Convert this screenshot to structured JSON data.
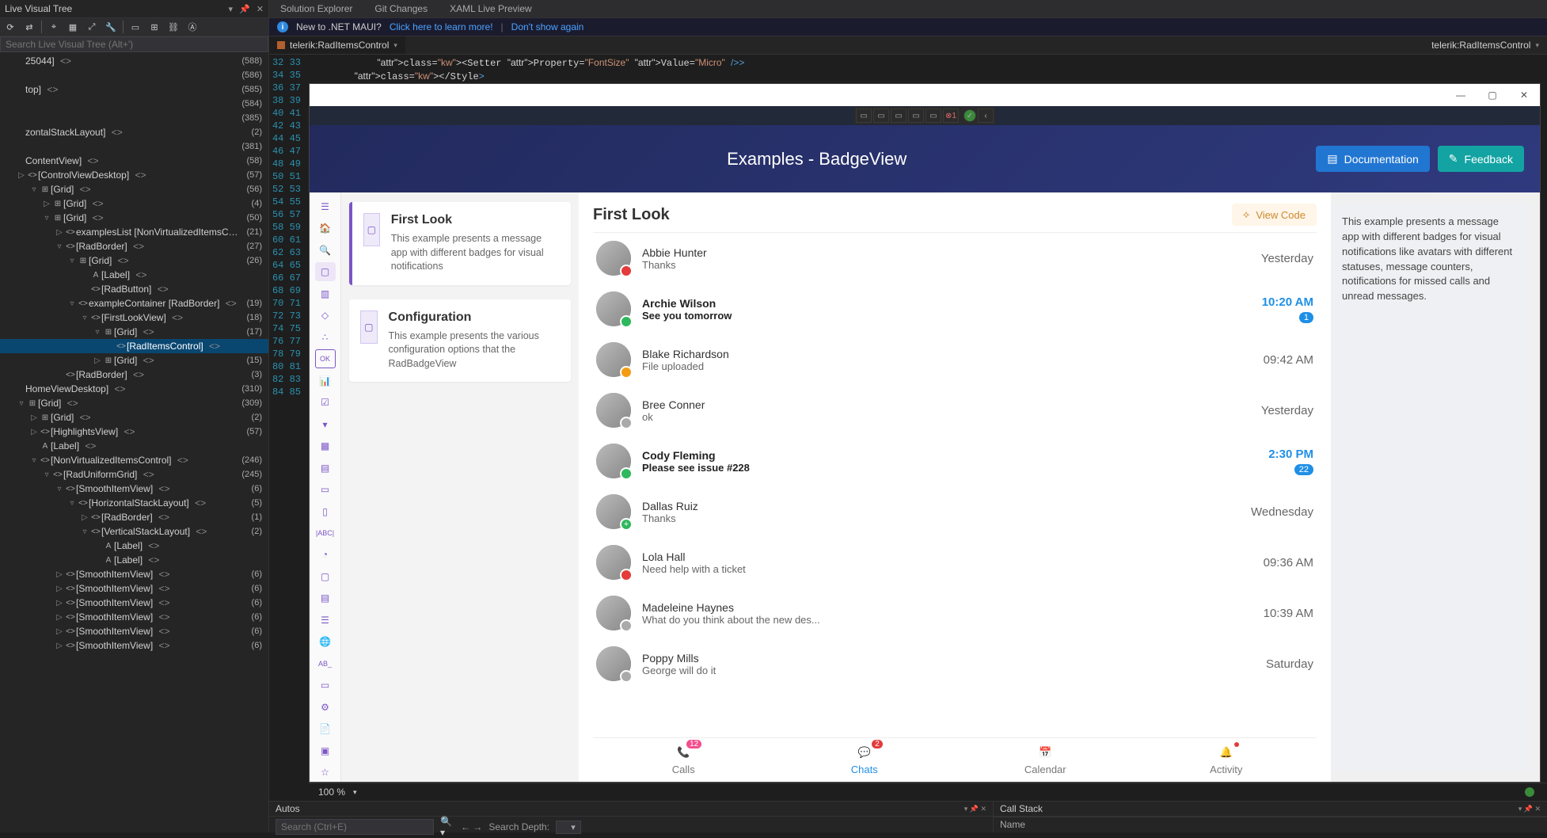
{
  "lvt": {
    "title": "Live Visual Tree",
    "search_placeholder": "Search Live Visual Tree (Alt+')",
    "rows": [
      {
        "indent": 0,
        "exp": "",
        "icon": "",
        "label": "25044]",
        "brak": "<>",
        "count": "(588)",
        "sel": false
      },
      {
        "indent": 0,
        "exp": "",
        "icon": "",
        "label": "",
        "brak": "",
        "count": "(586)",
        "sel": false
      },
      {
        "indent": 0,
        "exp": "",
        "icon": "",
        "label": "top]",
        "brak": "<>",
        "count": "(585)",
        "sel": false
      },
      {
        "indent": 0,
        "exp": "",
        "icon": "",
        "label": "",
        "brak": "",
        "count": "(584)",
        "sel": false
      },
      {
        "indent": 0,
        "exp": "",
        "icon": "",
        "label": "",
        "brak": "",
        "count": "(385)",
        "sel": false
      },
      {
        "indent": 0,
        "exp": "",
        "icon": "",
        "label": "zontalStackLayout]",
        "brak": "<>",
        "count": "(2)",
        "sel": false
      },
      {
        "indent": 0,
        "exp": "",
        "icon": "",
        "label": "",
        "brak": "",
        "count": "(381)",
        "sel": false
      },
      {
        "indent": 0,
        "exp": "",
        "icon": "",
        "label": "ContentView]",
        "brak": "<>",
        "count": "(58)",
        "sel": false
      },
      {
        "indent": 1,
        "exp": "▷",
        "icon": "<>",
        "label": "[ControlViewDesktop]",
        "brak": "<>",
        "count": "(57)",
        "sel": false
      },
      {
        "indent": 2,
        "exp": "▿",
        "icon": "⊞",
        "label": "[Grid]",
        "brak": "<>",
        "count": "(56)",
        "sel": false
      },
      {
        "indent": 3,
        "exp": "▷",
        "icon": "⊞",
        "label": "[Grid]",
        "brak": "<>",
        "count": "(4)",
        "sel": false
      },
      {
        "indent": 3,
        "exp": "▿",
        "icon": "⊞",
        "label": "[Grid]",
        "brak": "<>",
        "count": "(50)",
        "sel": false
      },
      {
        "indent": 4,
        "exp": "▷",
        "icon": "<>",
        "label": "examplesList [NonVirtualizedItemsControl]",
        "brak": "<>",
        "count": "(21)",
        "sel": false
      },
      {
        "indent": 4,
        "exp": "▿",
        "icon": "<>",
        "label": "[RadBorder]",
        "brak": "<>",
        "count": "(27)",
        "sel": false
      },
      {
        "indent": 5,
        "exp": "▿",
        "icon": "⊞",
        "label": "[Grid]",
        "brak": "<>",
        "count": "(26)",
        "sel": false
      },
      {
        "indent": 6,
        "exp": "",
        "icon": "A",
        "label": "[Label]",
        "brak": "<>",
        "count": "",
        "sel": false
      },
      {
        "indent": 6,
        "exp": "",
        "icon": "<>",
        "label": "[RadButton]",
        "brak": "<>",
        "count": "",
        "sel": false
      },
      {
        "indent": 5,
        "exp": "▿",
        "icon": "<>",
        "label": "exampleContainer [RadBorder]",
        "brak": "<>",
        "count": "(19)",
        "sel": false
      },
      {
        "indent": 6,
        "exp": "▿",
        "icon": "<>",
        "label": "[FirstLookView]",
        "brak": "<>",
        "count": "(18)",
        "sel": false
      },
      {
        "indent": 7,
        "exp": "▿",
        "icon": "⊞",
        "label": "[Grid]",
        "brak": "<>",
        "count": "(17)",
        "sel": false
      },
      {
        "indent": 8,
        "exp": "",
        "icon": "<>",
        "label": "[RadItemsControl]",
        "brak": "<>",
        "count": "",
        "sel": true
      },
      {
        "indent": 7,
        "exp": "▷",
        "icon": "⊞",
        "label": "[Grid]",
        "brak": "<>",
        "count": "(15)",
        "sel": false
      },
      {
        "indent": 4,
        "exp": "",
        "icon": "<>",
        "label": "[RadBorder]",
        "brak": "<>",
        "count": "(3)",
        "sel": false
      },
      {
        "indent": 0,
        "exp": "",
        "icon": "",
        "label": "HomeViewDesktop]",
        "brak": "<>",
        "count": "(310)",
        "sel": false
      },
      {
        "indent": 1,
        "exp": "▿",
        "icon": "⊞",
        "label": "[Grid]",
        "brak": "<>",
        "count": "(309)",
        "sel": false
      },
      {
        "indent": 2,
        "exp": "▷",
        "icon": "⊞",
        "label": "[Grid]",
        "brak": "<>",
        "count": "(2)",
        "sel": false
      },
      {
        "indent": 2,
        "exp": "▷",
        "icon": "<>",
        "label": "[HighlightsView]",
        "brak": "<>",
        "count": "(57)",
        "sel": false
      },
      {
        "indent": 2,
        "exp": "",
        "icon": "A",
        "label": "[Label]",
        "brak": "<>",
        "count": "",
        "sel": false
      },
      {
        "indent": 2,
        "exp": "▿",
        "icon": "<>",
        "label": "[NonVirtualizedItemsControl]",
        "brak": "<>",
        "count": "(246)",
        "sel": false
      },
      {
        "indent": 3,
        "exp": "▿",
        "icon": "<>",
        "label": "[RadUniformGrid]",
        "brak": "<>",
        "count": "(245)",
        "sel": false
      },
      {
        "indent": 4,
        "exp": "▿",
        "icon": "<>",
        "label": "[SmoothItemView]",
        "brak": "<>",
        "count": "(6)",
        "sel": false
      },
      {
        "indent": 5,
        "exp": "▿",
        "icon": "<>",
        "label": "[HorizontalStackLayout]",
        "brak": "<>",
        "count": "(5)",
        "sel": false
      },
      {
        "indent": 6,
        "exp": "▷",
        "icon": "<>",
        "label": "[RadBorder]",
        "brak": "<>",
        "count": "(1)",
        "sel": false
      },
      {
        "indent": 6,
        "exp": "▿",
        "icon": "<>",
        "label": "[VerticalStackLayout]",
        "brak": "<>",
        "count": "(2)",
        "sel": false
      },
      {
        "indent": 7,
        "exp": "",
        "icon": "A",
        "label": "[Label]",
        "brak": "<>",
        "count": "",
        "sel": false
      },
      {
        "indent": 7,
        "exp": "",
        "icon": "A",
        "label": "[Label]",
        "brak": "<>",
        "count": "",
        "sel": false
      },
      {
        "indent": 4,
        "exp": "▷",
        "icon": "<>",
        "label": "[SmoothItemView]",
        "brak": "<>",
        "count": "(6)",
        "sel": false
      },
      {
        "indent": 4,
        "exp": "▷",
        "icon": "<>",
        "label": "[SmoothItemView]",
        "brak": "<>",
        "count": "(6)",
        "sel": false
      },
      {
        "indent": 4,
        "exp": "▷",
        "icon": "<>",
        "label": "[SmoothItemView]",
        "brak": "<>",
        "count": "(6)",
        "sel": false
      },
      {
        "indent": 4,
        "exp": "▷",
        "icon": "<>",
        "label": "[SmoothItemView]",
        "brak": "<>",
        "count": "(6)",
        "sel": false
      },
      {
        "indent": 4,
        "exp": "▷",
        "icon": "<>",
        "label": "[SmoothItemView]",
        "brak": "<>",
        "count": "(6)",
        "sel": false
      },
      {
        "indent": 4,
        "exp": "▷",
        "icon": "<>",
        "label": "[SmoothItemView]",
        "brak": "<>",
        "count": "(6)",
        "sel": false
      }
    ]
  },
  "tabs": {
    "items": [
      "Solution Explorer",
      "Git Changes",
      "XAML Live Preview"
    ]
  },
  "maui": {
    "text": "New to .NET MAUI?",
    "link1": "Click here to learn more!",
    "link2": "Don't show again"
  },
  "editor_tabs": {
    "left": "telerik:RadItemsControl",
    "right": "telerik:RadItemsControl"
  },
  "code": {
    "first_line": 32,
    "line_count": 54,
    "lines": [
      "            <Setter Property=\"FontSize\" Value=\"Micro\" />",
      "        </Style>"
    ]
  },
  "zoom": {
    "pct": "100 %"
  },
  "app": {
    "title": "Examples - BadgeView",
    "documentation": "Documentation",
    "feedback": "Feedback",
    "view_code": "View Code",
    "first_look": "First Look",
    "cards": [
      {
        "title": "First Look",
        "desc": "This example presents a message app with different badges for visual notifications",
        "selected": true
      },
      {
        "title": "Configuration",
        "desc": "This example presents the various configuration options that the RadBadgeView",
        "selected": false
      }
    ],
    "chats": [
      {
        "name": "Abbie Hunter",
        "msg": "Thanks",
        "time": "Yesterday",
        "unread": false,
        "badge": "red",
        "count": ""
      },
      {
        "name": "Archie Wilson",
        "msg": "See you tomorrow",
        "time": "10:20 AM",
        "unread": true,
        "badge": "green",
        "count": "1"
      },
      {
        "name": "Blake Richardson",
        "msg": "File uploaded",
        "time": "09:42 AM",
        "unread": false,
        "badge": "orange",
        "count": ""
      },
      {
        "name": "Bree Conner",
        "msg": "ok",
        "time": "Yesterday",
        "unread": false,
        "badge": "gray",
        "count": ""
      },
      {
        "name": "Cody Fleming",
        "msg": "Please see issue #228",
        "time": "2:30 PM",
        "unread": true,
        "badge": "green",
        "count": "22"
      },
      {
        "name": "Dallas Ruiz",
        "msg": "Thanks",
        "time": "Wednesday",
        "unread": false,
        "badge": "greenplus",
        "count": ""
      },
      {
        "name": "Lola Hall",
        "msg": "Need help with a ticket",
        "time": "09:36 AM",
        "unread": false,
        "badge": "red",
        "count": ""
      },
      {
        "name": "Madeleine Haynes",
        "msg": "What do you think about the new des...",
        "time": "10:39 AM",
        "unread": false,
        "badge": "gray",
        "count": ""
      },
      {
        "name": "Poppy Mills",
        "msg": "George will do it",
        "time": "Saturday",
        "unread": false,
        "badge": "gray",
        "count": ""
      }
    ],
    "bottom_tabs": [
      {
        "label": "Calls",
        "badge": "12",
        "badge_color": "pink",
        "active": false,
        "dot": false
      },
      {
        "label": "Chats",
        "badge": "2",
        "badge_color": "red",
        "active": true,
        "dot": false
      },
      {
        "label": "Calendar",
        "badge": "",
        "badge_color": "",
        "active": false,
        "dot": false
      },
      {
        "label": "Activity",
        "badge": "",
        "badge_color": "",
        "active": false,
        "dot": true
      }
    ],
    "info": "This example presents a message app with different badges for visual notifications like avatars with different statuses, message counters, notifications for missed calls and unread messages."
  },
  "bottom": {
    "autos_title": "Autos",
    "search_placeholder": "Search (Ctrl+E)",
    "depth_label": "Search Depth:",
    "callstack_title": "Call Stack",
    "callstack_col": "Name"
  }
}
